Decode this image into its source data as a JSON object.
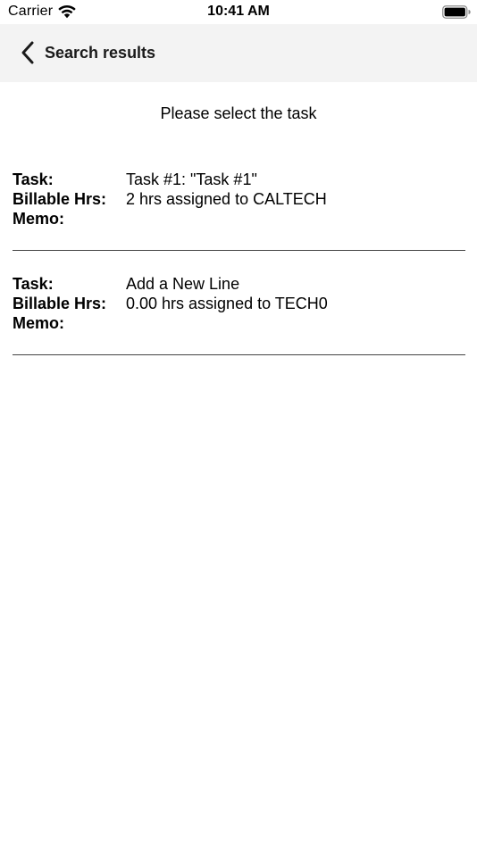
{
  "status_bar": {
    "carrier": "Carrier",
    "time": "10:41 AM"
  },
  "nav": {
    "back_label": "Search results"
  },
  "prompt": "Please select the task",
  "labels": {
    "task": "Task:",
    "billable": "Billable Hrs:",
    "memo": "Memo:"
  },
  "tasks": [
    {
      "task": "Task #1: \"Task #1\"",
      "billable": "2 hrs assigned to CALTECH",
      "memo": ""
    },
    {
      "task": "Add a New Line",
      "billable": "0.00 hrs assigned to TECH0",
      "memo": ""
    }
  ],
  "colors": {
    "nav_background": "#f3f3f3",
    "divider": "#444444"
  },
  "icons": {
    "wifi": "wifi-icon",
    "battery": "battery-icon",
    "back": "chevron-left-icon"
  }
}
